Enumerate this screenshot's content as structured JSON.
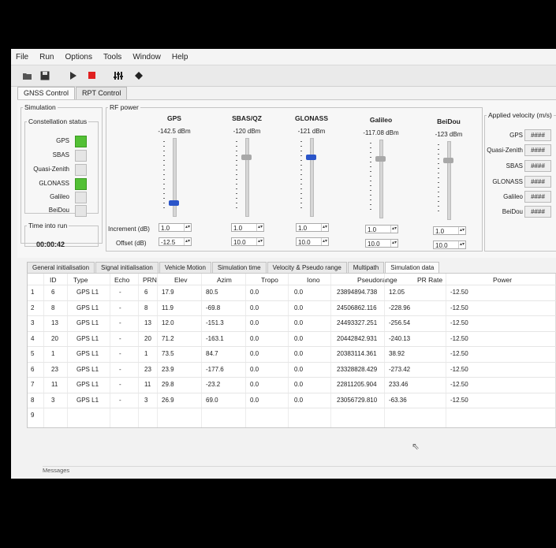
{
  "menu": [
    "File",
    "Run",
    "Options",
    "Tools",
    "Window",
    "Help"
  ],
  "toolbar": {
    "icons": [
      "open-folder-icon",
      "save-icon",
      "play-icon",
      "stop-icon",
      "equalizer-icon",
      "diamond-icon"
    ]
  },
  "top_tabs": [
    {
      "label": "GNSS Control",
      "active": true
    },
    {
      "label": "RPT Control",
      "active": false
    }
  ],
  "simulation": {
    "title": "Simulation",
    "constellation_title": "Constellation status",
    "constellations": [
      {
        "label": "GPS",
        "on": true
      },
      {
        "label": "SBAS",
        "on": false
      },
      {
        "label": "Quasi-Zenith",
        "on": false
      },
      {
        "label": "GLONASS",
        "on": true
      },
      {
        "label": "Galileo",
        "on": false
      },
      {
        "label": "BeiDou",
        "on": false
      }
    ],
    "time_title": "Time into run",
    "time_value": "00:00:42"
  },
  "rf_power": {
    "title": "RF power",
    "increment_label": "Increment (dB)",
    "offset_label": "Offset (dB)",
    "columns": [
      {
        "name": "GPS",
        "dbm": "-142.5 dBm",
        "increment": "1.0",
        "offset": "-12.5",
        "active": true
      },
      {
        "name": "SBAS/QZ",
        "dbm": "-120 dBm",
        "increment": "1.0",
        "offset": "10.0",
        "active": false
      },
      {
        "name": "GLONASS",
        "dbm": "-121 dBm",
        "increment": "1.0",
        "offset": "10.0",
        "active": true
      },
      {
        "name": "Galileo",
        "dbm": "-117.08 dBm",
        "increment": "1.0",
        "offset": "10.0",
        "active": false
      },
      {
        "name": "BeiDou",
        "dbm": "-123 dBm",
        "increment": "1.0",
        "offset": "10.0",
        "active": false
      }
    ]
  },
  "applied_velocity": {
    "title": "Applied velocity (m/s)",
    "rows": [
      {
        "label": "GPS",
        "value": "####"
      },
      {
        "label": "Quasi-Zenith",
        "value": "####"
      },
      {
        "label": "SBAS",
        "value": "####"
      },
      {
        "label": "GLONASS",
        "value": "####"
      },
      {
        "label": "Galileo",
        "value": "####"
      },
      {
        "label": "BeiDou",
        "value": "####"
      }
    ]
  },
  "bottom_tabs": [
    {
      "label": "General initialisation",
      "active": false
    },
    {
      "label": "Signal initialisation",
      "active": false
    },
    {
      "label": "Vehicle Motion",
      "active": false
    },
    {
      "label": "Simulation time",
      "active": false
    },
    {
      "label": "Velocity & Pseudo range",
      "active": false
    },
    {
      "label": "Multipath",
      "active": false
    },
    {
      "label": "Simulation data",
      "active": true
    }
  ],
  "table": {
    "headers": [
      "ID",
      "Type",
      "Echo",
      "PRN",
      "Elev",
      "Azim",
      "Tropo",
      "Iono",
      "Pseudorange",
      "PR Rate",
      "Power"
    ],
    "rows": [
      {
        "n": "1",
        "id": "6",
        "type": "GPS L1",
        "echo": "-",
        "prn": "6",
        "elev": "17.9",
        "azim": "80.5",
        "tropo": "0.0",
        "iono": "0.0",
        "pr": "23894894.738",
        "prr": "12.05",
        "power": "-12.50"
      },
      {
        "n": "2",
        "id": "8",
        "type": "GPS L1",
        "echo": "-",
        "prn": "8",
        "elev": "11.9",
        "azim": "-69.8",
        "tropo": "0.0",
        "iono": "0.0",
        "pr": "24506862.116",
        "prr": "-228.96",
        "power": "-12.50"
      },
      {
        "n": "3",
        "id": "13",
        "type": "GPS L1",
        "echo": "-",
        "prn": "13",
        "elev": "12.0",
        "azim": "-151.3",
        "tropo": "0.0",
        "iono": "0.0",
        "pr": "24493327.251",
        "prr": "-256.54",
        "power": "-12.50"
      },
      {
        "n": "4",
        "id": "20",
        "type": "GPS L1",
        "echo": "-",
        "prn": "20",
        "elev": "71.2",
        "azim": "-163.1",
        "tropo": "0.0",
        "iono": "0.0",
        "pr": "20442842.931",
        "prr": "-240.13",
        "power": "-12.50"
      },
      {
        "n": "5",
        "id": "1",
        "type": "GPS L1",
        "echo": "-",
        "prn": "1",
        "elev": "73.5",
        "azim": "84.7",
        "tropo": "0.0",
        "iono": "0.0",
        "pr": "20383114.361",
        "prr": "38.92",
        "power": "-12.50"
      },
      {
        "n": "6",
        "id": "23",
        "type": "GPS L1",
        "echo": "-",
        "prn": "23",
        "elev": "23.9",
        "azim": "-177.6",
        "tropo": "0.0",
        "iono": "0.0",
        "pr": "23328828.429",
        "prr": "-273.42",
        "power": "-12.50"
      },
      {
        "n": "7",
        "id": "11",
        "type": "GPS L1",
        "echo": "-",
        "prn": "11",
        "elev": "29.8",
        "azim": "-23.2",
        "tropo": "0.0",
        "iono": "0.0",
        "pr": "22811205.904",
        "prr": "233.46",
        "power": "-12.50"
      },
      {
        "n": "8",
        "id": "3",
        "type": "GPS L1",
        "echo": "-",
        "prn": "3",
        "elev": "26.9",
        "azim": "69.0",
        "tropo": "0.0",
        "iono": "0.0",
        "pr": "23056729.810",
        "prr": "-63.36",
        "power": "-12.50"
      },
      {
        "n": "9",
        "id": "",
        "type": "",
        "echo": "",
        "prn": "",
        "elev": "",
        "azim": "",
        "tropo": "",
        "iono": "",
        "pr": "",
        "prr": "",
        "power": ""
      }
    ]
  },
  "status": {
    "messages_label": "Messages"
  }
}
